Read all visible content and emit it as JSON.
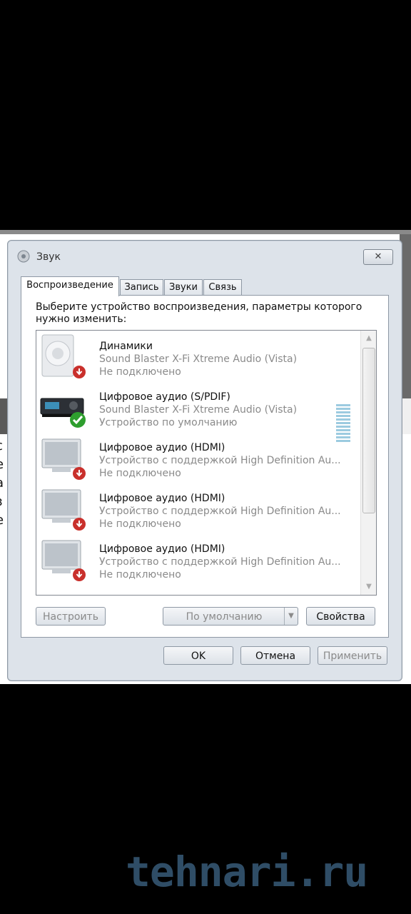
{
  "window": {
    "title": "Звук",
    "close_label": "✕"
  },
  "tabs": [
    {
      "label": "Воспроизведение",
      "active": true
    },
    {
      "label": "Запись",
      "active": false
    },
    {
      "label": "Звуки",
      "active": false
    },
    {
      "label": "Связь",
      "active": false
    }
  ],
  "panel": {
    "instruction": "Выберите устройство воспроизведения, параметры которого нужно изменить:"
  },
  "devices": [
    {
      "name": "Динамики",
      "desc": "Sound Blaster X-Fi Xtreme Audio (Vista)",
      "status": "Не подключено",
      "icon": "speaker-icon",
      "badge": "disconnected-badge-icon"
    },
    {
      "name": "Цифровое аудио (S/PDIF)",
      "desc": "Sound Blaster X-Fi Xtreme Audio (Vista)",
      "status": "Устройство по умолчанию",
      "icon": "digital-receiver-icon",
      "badge": "default-checkmark-icon"
    },
    {
      "name": "Цифровое аудио (HDMI)",
      "desc": "Устройство с поддержкой High Definition Au...",
      "status": "Не подключено",
      "icon": "monitor-icon",
      "badge": "disconnected-badge-icon"
    },
    {
      "name": "Цифровое аудио (HDMI)",
      "desc": "Устройство с поддержкой High Definition Au...",
      "status": "Не подключено",
      "icon": "monitor-icon",
      "badge": "disconnected-badge-icon"
    },
    {
      "name": "Цифровое аудио (HDMI)",
      "desc": "Устройство с поддержкой High Definition Au...",
      "status": "Не подключено",
      "icon": "monitor-icon",
      "badge": "disconnected-badge-icon"
    }
  ],
  "buttons": {
    "configure": "Настроить",
    "set_default": "По умолчанию",
    "properties": "Свойства",
    "ok": "OK",
    "cancel": "Отмена",
    "apply": "Применить"
  },
  "background": {
    "left_fragments": [
      "с",
      "е",
      "а",
      "з",
      "е"
    ]
  },
  "watermark": "tehnari.ru",
  "colors": {
    "accent_check": "#2e9e2e",
    "disconnected_badge": "#c9302c",
    "secondary_text": "#8a8a8a"
  }
}
